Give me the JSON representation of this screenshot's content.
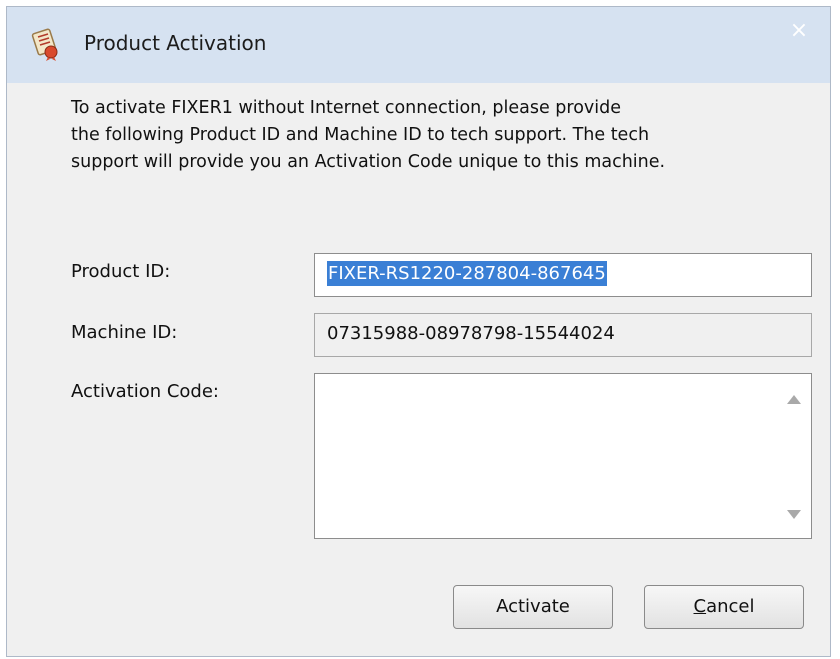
{
  "window": {
    "title": "Product Activation",
    "close_glyph": "×"
  },
  "description": "To activate FIXER1 without Internet connection, please provide\nthe following Product ID and Machine ID to tech support. The tech\nsupport will provide you an Activation Code unique to this machine.",
  "fields": {
    "product_id_label": "Product ID:",
    "product_id_value": "FIXER-RS1220-287804-867645",
    "machine_id_label": "Machine ID:",
    "machine_id_value": "07315988-08978798-15544024",
    "activation_code_label": "Activation Code:",
    "activation_code_value": ""
  },
  "buttons": {
    "activate_label": "Activate",
    "cancel_accel": "C",
    "cancel_rest": "ancel"
  },
  "colors": {
    "titlebar": "#d6e2f1",
    "selection": "#3a7fd5"
  },
  "icons": {
    "app": "certificate-icon",
    "close": "close-icon"
  }
}
